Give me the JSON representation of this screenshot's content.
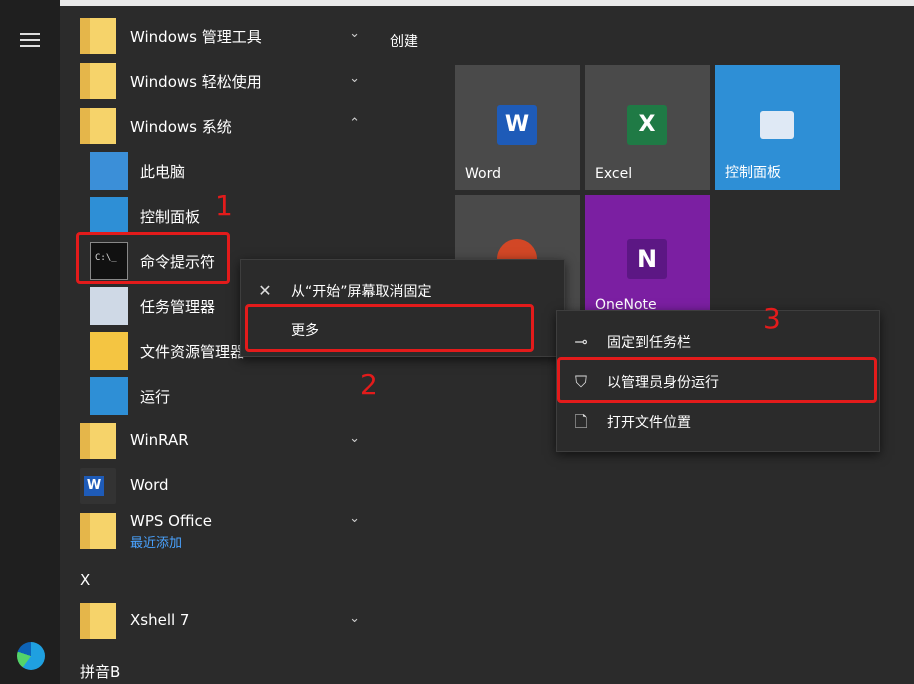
{
  "left_rail": {
    "menu_icon": "hamburger-icon",
    "app_icon": "edge-icon"
  },
  "app_list": [
    {
      "label": "Windows 管理工具",
      "icon": "folder-icon",
      "chevron": "⌄"
    },
    {
      "label": "Windows 轻松使用",
      "icon": "folder-icon",
      "chevron": "⌄"
    },
    {
      "label": "Windows 系统",
      "icon": "folder-icon",
      "chevron": "⌃"
    },
    {
      "label": "此电脑",
      "icon": "computer-icon"
    },
    {
      "label": "控制面板",
      "icon": "control-panel-icon"
    },
    {
      "label": "命令提示符",
      "icon": "cmd-icon"
    },
    {
      "label": "任务管理器",
      "icon": "task-manager-icon"
    },
    {
      "label": "文件资源管理器",
      "icon": "file-explorer-icon"
    },
    {
      "label": "运行",
      "icon": "run-icon"
    },
    {
      "label": "WinRAR",
      "icon": "folder-icon",
      "chevron": "⌄"
    },
    {
      "label": "Word",
      "icon": "word-icon"
    },
    {
      "label": "WPS Office",
      "sublabel": "最近添加",
      "icon": "folder-icon",
      "chevron": "⌄"
    },
    {
      "label": "Xshell 7",
      "icon": "folder-icon",
      "chevron": "⌄"
    }
  ],
  "letter_headers": [
    "X",
    "拼音B"
  ],
  "tiles": {
    "group_title": "创建",
    "items": [
      {
        "label": "Word",
        "icon": "word-icon",
        "color": "#4a4a4a"
      },
      {
        "label": "Excel",
        "icon": "excel-icon",
        "color": "#4a4a4a"
      },
      {
        "label": "控制面板",
        "icon": "control-panel-icon",
        "color": "#2e8fd6"
      },
      {
        "label": "",
        "icon": "powerpoint-icon",
        "color": "#4a4a4a"
      },
      {
        "label": "OneNote",
        "icon": "onenote-icon",
        "color": "#7b1fa2"
      }
    ]
  },
  "context_menu": {
    "items": [
      {
        "label": "从“开始”屏幕取消固定",
        "icon": "unpin-icon"
      },
      {
        "label": "更多",
        "icon": "",
        "arrow": "›"
      }
    ]
  },
  "submenu": {
    "items": [
      {
        "label": "固定到任务栏",
        "icon": "pin-icon"
      },
      {
        "label": "以管理员身份运行",
        "icon": "shield-icon"
      },
      {
        "label": "打开文件位置",
        "icon": "file-icon"
      }
    ]
  },
  "annotations": {
    "step1": "1",
    "step2": "2",
    "step3": "3"
  },
  "colors": {
    "highlight": "#e31b1b",
    "accent_blue": "#2e8fd6",
    "onenote": "#7b1fa2"
  }
}
